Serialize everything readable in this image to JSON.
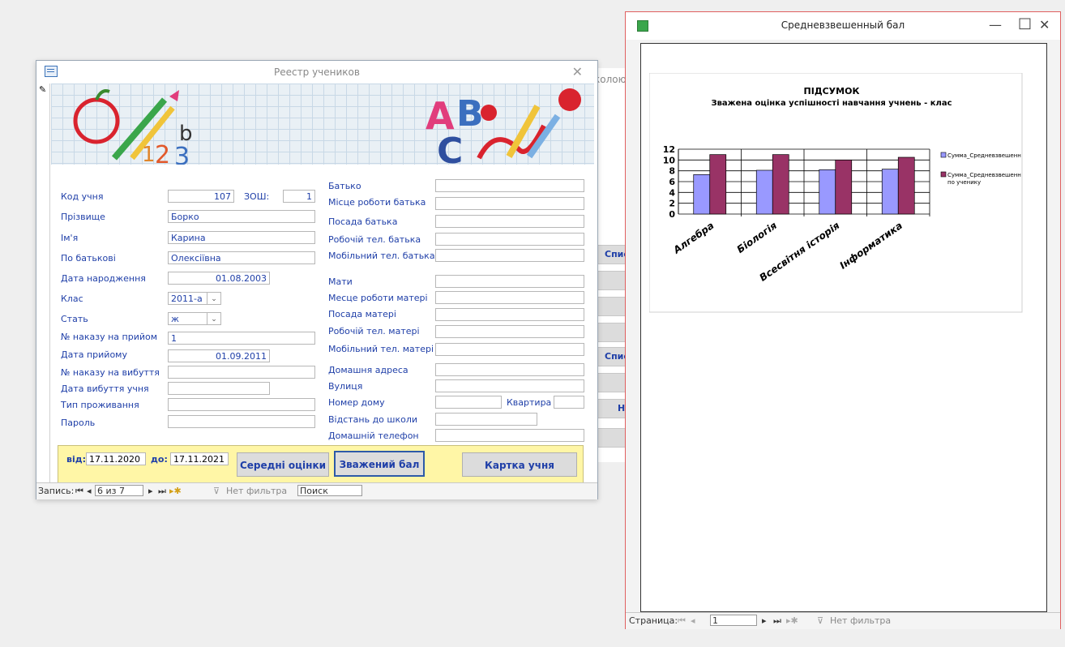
{
  "background": {
    "title_fragment": "колою",
    "buttons": [
      "Спис",
      "С",
      "",
      "",
      "Спис",
      "",
      "На",
      ""
    ]
  },
  "form": {
    "title": "Реестр учеников",
    "close": "✕",
    "left_fields": [
      {
        "label": "Код учня",
        "value": "107"
      },
      {
        "label": "Прізвище",
        "value": "Борко"
      },
      {
        "label": "Ім'я",
        "value": "Карина"
      },
      {
        "label": "По батькові",
        "value": "Олексіївна"
      },
      {
        "label": "Дата народження",
        "value": "01.08.2003"
      },
      {
        "label": "Клас",
        "value": "2011-а"
      },
      {
        "label": "Стать",
        "value": "ж"
      },
      {
        "label": "№ наказу на прийом",
        "value": "1"
      },
      {
        "label": "Дата прийому",
        "value": "01.09.2011"
      },
      {
        "label": "№ наказу на вибуття",
        "value": ""
      },
      {
        "label": "Дата вибуття учня",
        "value": ""
      },
      {
        "label": "Тип проживання",
        "value": ""
      },
      {
        "label": "Пароль",
        "value": ""
      }
    ],
    "school": {
      "label": "ЗОШ:",
      "value": "1"
    },
    "right_fields": [
      {
        "label": "Батько",
        "value": ""
      },
      {
        "label": "Місце роботи батька",
        "value": ""
      },
      {
        "label": "Посада батька",
        "value": ""
      },
      {
        "label": "Робочій тел. батька",
        "value": ""
      },
      {
        "label": "Мобільний тел. батька",
        "value": ""
      },
      {
        "label": "Мати",
        "value": ""
      },
      {
        "label": "Месце роботи матері",
        "value": ""
      },
      {
        "label": "Посада матері",
        "value": ""
      },
      {
        "label": "Робочій тел. матері",
        "value": ""
      },
      {
        "label": "Мобільний тел. матері",
        "value": ""
      },
      {
        "label": "Домашня адреса",
        "value": ""
      },
      {
        "label": "Вулиця",
        "value": ""
      },
      {
        "label": "Номер дому",
        "value": ""
      },
      {
        "label": "Відстань до школи",
        "value": ""
      },
      {
        "label": "Домашній телефон",
        "value": ""
      }
    ],
    "apartment": {
      "label": "Квартира",
      "value": ""
    },
    "period": {
      "from_label": "від:",
      "from": "17.11.2020",
      "to_label": "до:",
      "to": "17.11.2021"
    },
    "buttons": {
      "avg": "Середні оцінки",
      "weighted": "Зважений бал",
      "card": "Картка учня"
    },
    "nav": {
      "record_label": "Запись:",
      "record": "6 из 7",
      "filter": "Нет фильтра",
      "search": "Поиск"
    }
  },
  "report": {
    "title": "Средневзвешенный бал",
    "nav": {
      "page_label": "Страница:",
      "page": "1",
      "filter": "Нет фильтра"
    }
  },
  "chart_data": {
    "type": "bar",
    "title": "ПІДСУМОК",
    "subtitle": "Зважена оцінка успішності навчання учнень - клас",
    "categories": [
      "Алгебра",
      "Біологія",
      "Всесвітня історія",
      "Інформатика"
    ],
    "series": [
      {
        "name": "Сумма_Средневзвешенн",
        "values": [
          7.3,
          8.1,
          8.2,
          8.3
        ],
        "color": "#9999ff"
      },
      {
        "name": "Сумма_Средневзвешенн по ученику",
        "values": [
          11.0,
          11.0,
          10.0,
          10.5
        ],
        "color": "#993366"
      }
    ],
    "yticks": [
      "0",
      "2",
      "4",
      "6",
      "8",
      "10",
      "12"
    ],
    "ylim": [
      0,
      12
    ],
    "legend": "right"
  }
}
